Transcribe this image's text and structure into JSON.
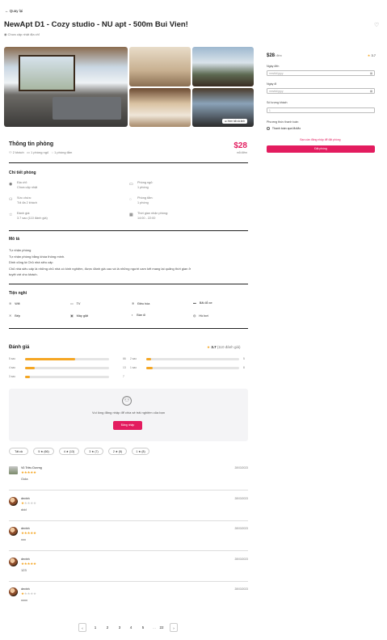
{
  "nav": {
    "back_label": "Quay lại"
  },
  "listing": {
    "title": "NewApt D1 - Cozy studio - NU apt - 500m Bui Vien!",
    "address_note": "Chưa cập nhật địa chỉ",
    "show_all_photos": "Xem tất cả ảnh"
  },
  "booking": {
    "price": "$28",
    "per_night": "/ đêm",
    "rating": "3.7",
    "checkin_label": "Ngày đến",
    "checkin_placeholder": "mm/dd/yyyy",
    "checkout_label": "Ngày đi",
    "checkout_placeholder": "mm/dd/yyyy",
    "guests_label": "Số lượng khách",
    "guests_value": "1",
    "payment_label": "Phương thức thanh toán",
    "payment_option": "Thanh toán qua MoMo",
    "login_notice": "Bạn cần đăng nhập để đặt phòng",
    "book_button": "Đặt phòng"
  },
  "room_info": {
    "heading": "Thông tin phòng",
    "guests": "2 khách",
    "bedrooms": "1 phòng ngủ",
    "bathrooms": "1 phòng tắm",
    "price": "$28",
    "price_unit": "mỗi đêm"
  },
  "details": {
    "heading": "Chi tiết phòng",
    "items": [
      {
        "label": "Địa chỉ:",
        "value": "Chưa cập nhật"
      },
      {
        "label": "Phòng ngủ:",
        "value": "1 phòng"
      },
      {
        "label": "Sức chứa:",
        "value": "Tối đa 2 khách"
      },
      {
        "label": "Phòng tắm:",
        "value": "1 phòng"
      },
      {
        "label": "Đánh giá:",
        "value": "3.7 sao (110 đánh giá)"
      },
      {
        "label": "Thời gian nhận phòng:",
        "value": "14:00 - 22:00"
      }
    ]
  },
  "description": {
    "heading": "Mô tả",
    "lines": [
      "Tự nhận phòng",
      "Tự nhận phòng bằng khóa thông minh.",
      "Dinh cũng là Chủ nhà siêu cấp",
      "Chủ nhà siêu cấp là những chủ nhà có kinh nghiệm, được đánh giá cao và là những người cam kết mang lại quãng thời gian ở",
      "tuyệt vời cho khách."
    ]
  },
  "amenities": {
    "heading": "Tiện nghi",
    "items": [
      "Wifi",
      "TV",
      "Điều hòa",
      "Bãi đỗ xe",
      "Bếp",
      "Máy giặt",
      "Bàn ủi",
      "Hồ bơi"
    ]
  },
  "reviews": {
    "heading": "Đánh giá",
    "avg": "3.7",
    "count": "(110 đánh giá)",
    "distribution": [
      {
        "label": "5 sao",
        "count": "66",
        "fraction": 0.6
      },
      {
        "label": "4 sao",
        "count": "13",
        "fraction": 0.12
      },
      {
        "label": "3 sao",
        "count": "7",
        "fraction": 0.06
      },
      {
        "label": "2 sao",
        "count": "5",
        "fraction": 0.05
      },
      {
        "label": "1 sao",
        "count": "8",
        "fraction": 0.07
      }
    ],
    "login_prompt": "Vui lòng đăng nhập để chia sẻ trải nghiệm của bạn",
    "login_button": "Đăng nhập",
    "filters": [
      "Tất cả",
      "5 ★ (66)",
      "4 ★ (13)",
      "3 ★ (7)",
      "2 ★ (5)",
      "1 ★ (8)"
    ],
    "list": [
      {
        "name": "Vũ Triều Dương",
        "date": "28/03/2023",
        "stars": 5,
        "text": "Oola"
      },
      {
        "name": "devinh",
        "date": "28/03/2023",
        "stars": 1,
        "text": "ddd"
      },
      {
        "name": "devinh",
        "date": "28/03/2023",
        "stars": 5,
        "text": "xxx"
      },
      {
        "name": "devinh",
        "date": "28/03/2023",
        "stars": 5,
        "text": "123"
      },
      {
        "name": "devinh",
        "date": "28/03/2023",
        "stars": 1,
        "text": "xxxx"
      }
    ]
  },
  "pagination": {
    "pages": [
      "1",
      "2",
      "3",
      "4",
      "5",
      "...",
      "22"
    ]
  },
  "colors": {
    "accent": "#e31c5f",
    "star": "#f5a623"
  }
}
